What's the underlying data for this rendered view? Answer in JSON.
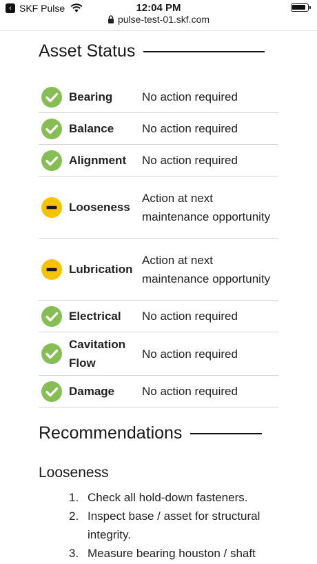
{
  "statusbar": {
    "app": "SKF Pulse",
    "time": "12:04 PM"
  },
  "urlbar": {
    "url": "pulse-test-01.skf.com"
  },
  "asset_status": {
    "title": "Asset Status",
    "rows": [
      {
        "name": "Bearing",
        "value": "No action required",
        "status": "ok"
      },
      {
        "name": "Balance",
        "value": "No action required",
        "status": "ok"
      },
      {
        "name": "Alignment",
        "value": "No action required",
        "status": "ok"
      },
      {
        "name": "Looseness",
        "value": "Action at next maintenance opportunity",
        "status": "warn"
      },
      {
        "name": "Lubrication",
        "value": "Action at next maintenance opportunity",
        "status": "warn"
      },
      {
        "name": "Electrical",
        "value": "No action required",
        "status": "ok"
      },
      {
        "name": "Cavitation Flow",
        "value": "No action required",
        "status": "ok"
      },
      {
        "name": "Damage",
        "value": "No action required",
        "status": "ok"
      }
    ]
  },
  "recommendations": {
    "title": "Recommendations",
    "subhead": "Looseness",
    "items": [
      {
        "num": "1.",
        "text": "Check all hold-down fasteners."
      },
      {
        "num": "2.",
        "text": "Inspect base / asset for structural integrity."
      },
      {
        "num": "3.",
        "text": "Measure bearing houston / shaft"
      }
    ]
  },
  "colors": {
    "ok": "#86bd55",
    "warn": "#f7c300"
  },
  "icons": {
    "ok": "checkmark-circle-icon",
    "warn": "minus-circle-icon"
  }
}
